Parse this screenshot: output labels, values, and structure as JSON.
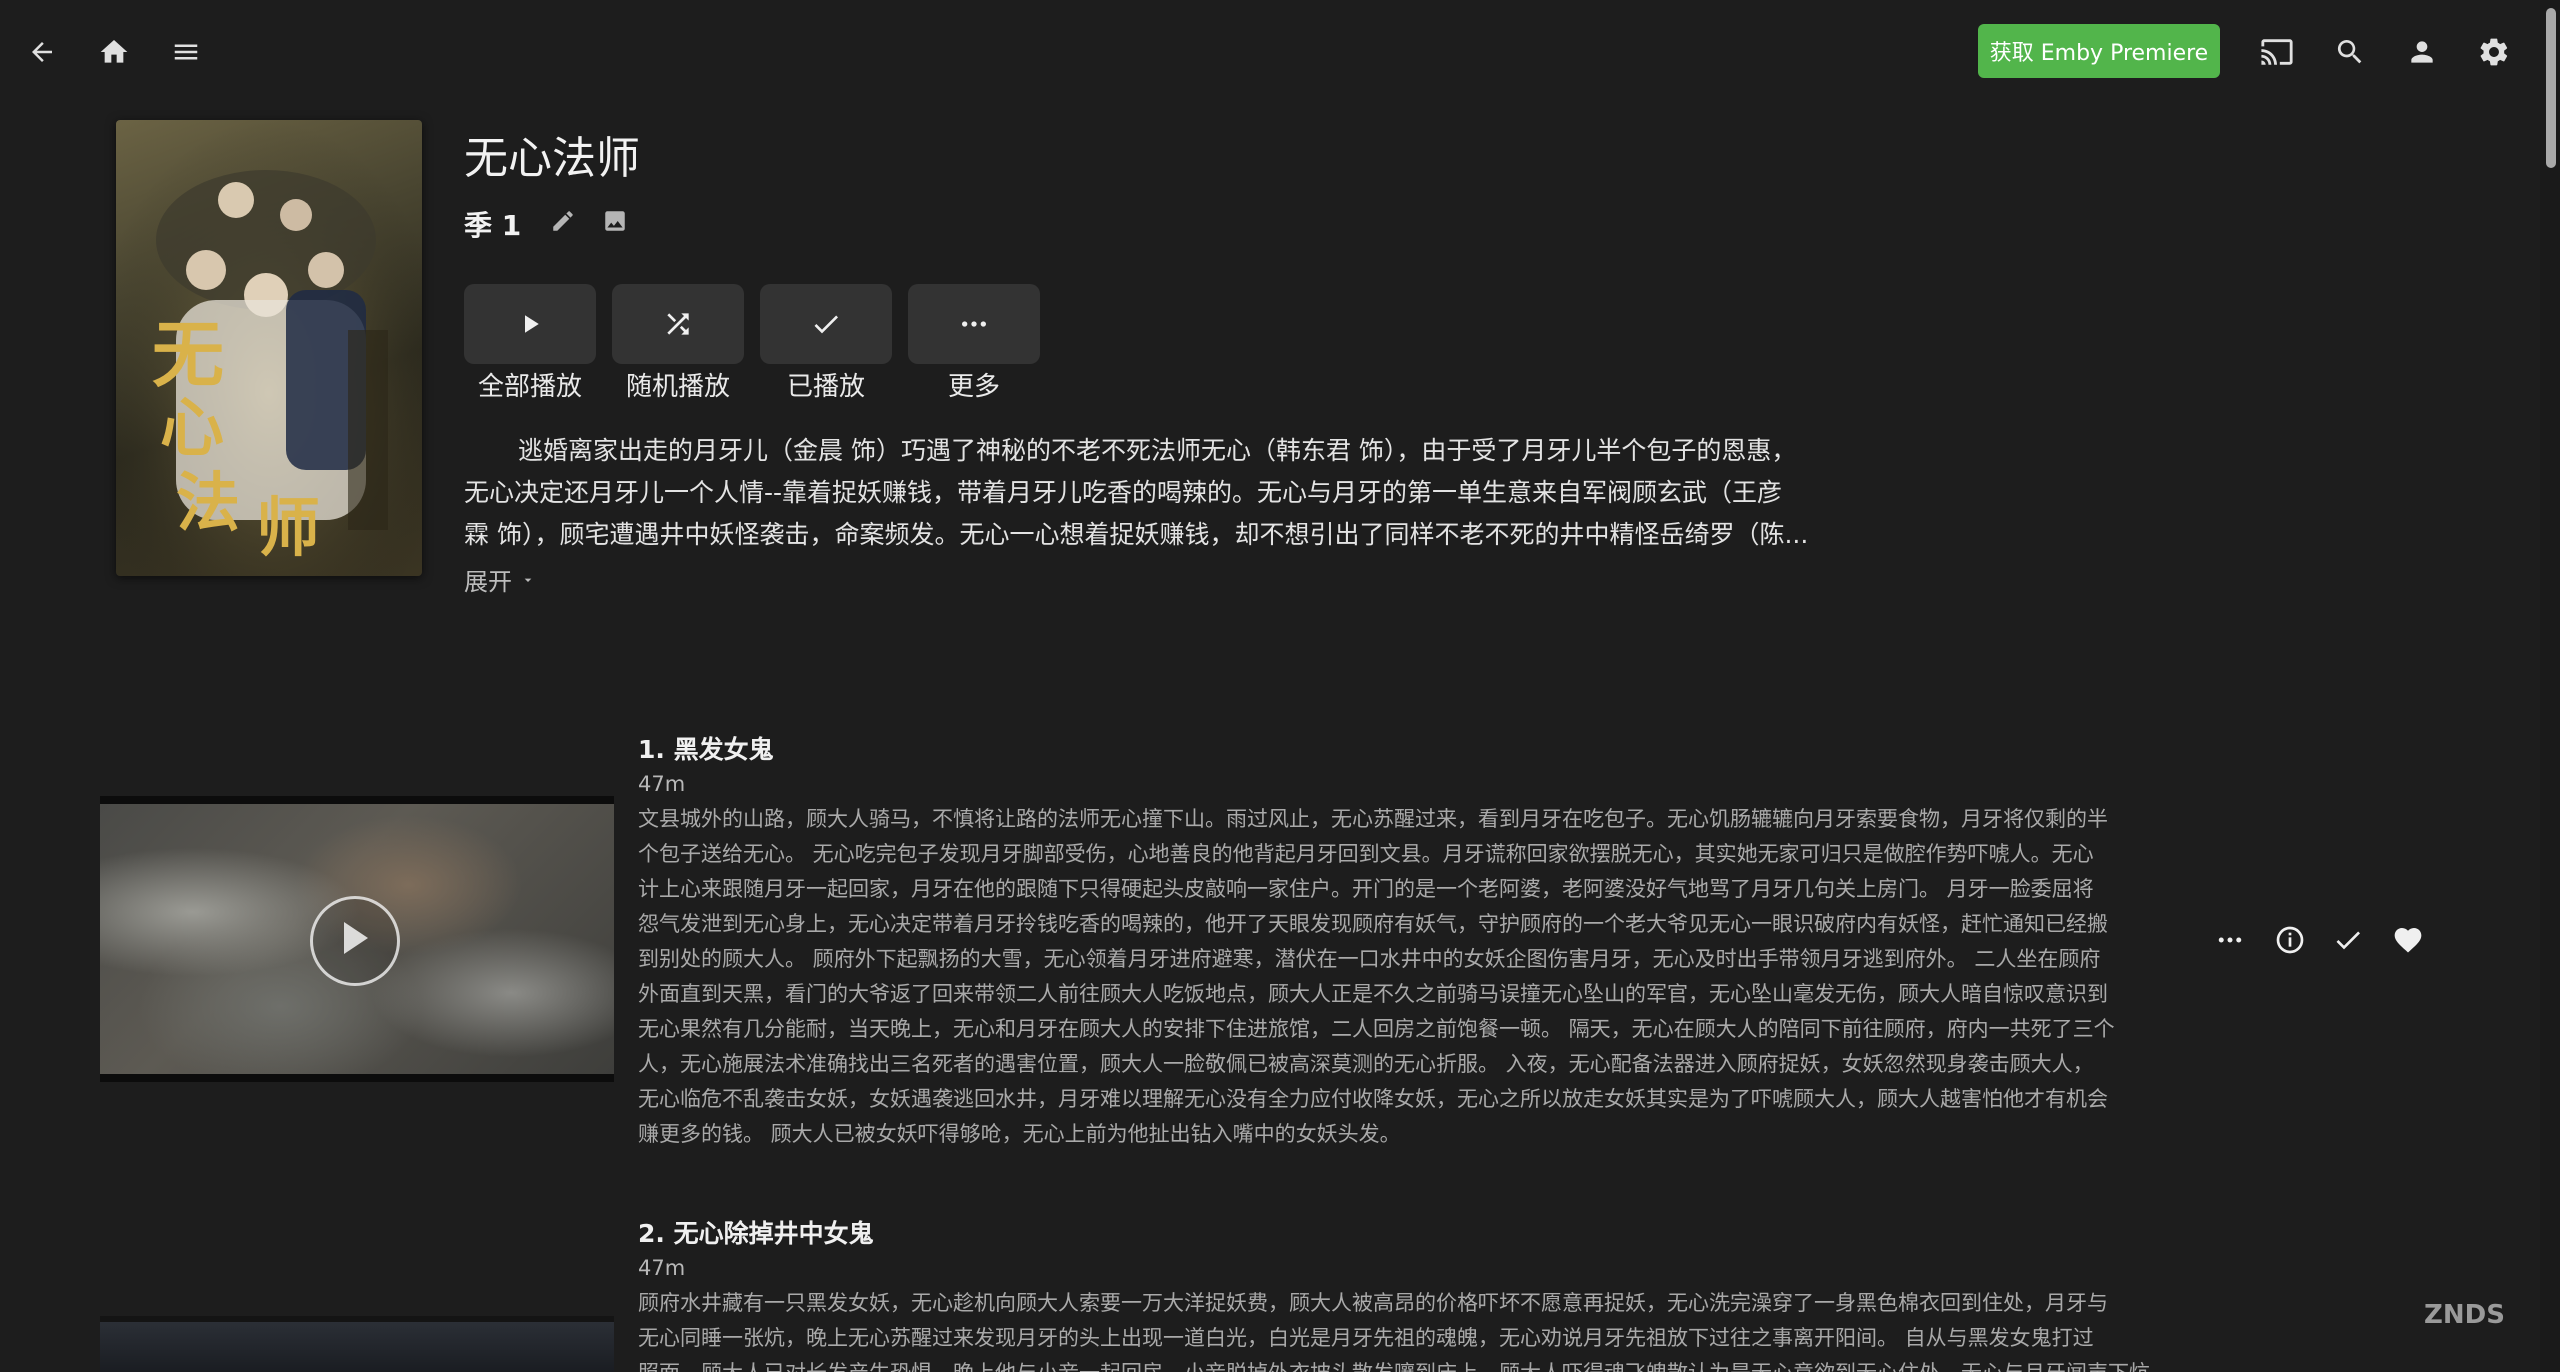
{
  "header": {
    "back_icon": "arrow-left-icon",
    "home_icon": "home-icon",
    "menu_icon": "hamburger-menu-icon",
    "premiere_label": "获取 Emby Premiere",
    "premiere_color": "#52b54b",
    "cast_icon": "cast-icon",
    "search_icon": "search-icon",
    "user_icon": "user-icon",
    "settings_icon": "gear-icon"
  },
  "show": {
    "title": "无心法师",
    "season": "季 1",
    "edit_icon": "pencil-icon",
    "image_icon": "image-icon",
    "overview_lines": [
      "逃婚离家出走的月牙儿（金晨 饰）巧遇了神秘的不老不死法师无心（韩东君 饰），由于受了月牙儿半个包子的恩惠，",
      "无心决定还月牙儿一个人情--靠着捉妖赚钱，带着月牙儿吃香的喝辣的。无心与月牙的第一单生意来自军阀顾玄武（王彦",
      "霖 饰），顾宅遭遇井中妖怪袭击，命案频发。无心一心想着捉妖赚钱，却不想引出了同样不老不死的井中精怪岳绮罗（陈..."
    ],
    "expand_label": "展开"
  },
  "actions": [
    {
      "label": "全部播放",
      "icon": "play-icon"
    },
    {
      "label": "随机播放",
      "icon": "shuffle-icon"
    },
    {
      "label": "已播放",
      "icon": "check-icon"
    },
    {
      "label": "更多",
      "icon": "more-horizontal-icon"
    }
  ],
  "episodes": [
    {
      "title": "1. 黑发女鬼",
      "runtime": "47m",
      "overview_lines": [
        "文县城外的山路，顾大人骑马，不慎将让路的法师无心撞下山。雨过风止，无心苏醒过来，看到月牙在吃包子。无心饥肠辘辘向月牙索要食物，月牙将仅剩的半",
        "个包子送给无心。 无心吃完包子发现月牙脚部受伤，心地善良的他背起月牙回到文县。月牙谎称回家欲摆脱无心，其实她无家可归只是做腔作势吓唬人。无心",
        "计上心来跟随月牙一起回家，月牙在他的跟随下只得硬起头皮敲响一家住户。开门的是一个老阿婆，老阿婆没好气地骂了月牙几句关上房门。 月牙一脸委屈将",
        "怨气发泄到无心身上，无心决定带着月牙拎钱吃香的喝辣的，他开了天眼发现顾府有妖气，守护顾府的一个老大爷见无心一眼识破府内有妖怪，赶忙通知已经搬",
        "到别处的顾大人。 顾府外下起飘扬的大雪，无心领着月牙进府避寒，潜伏在一口水井中的女妖企图伤害月牙，无心及时出手带领月牙逃到府外。 二人坐在顾府",
        "外面直到天黑，看门的大爷返了回来带领二人前往顾大人吃饭地点，顾大人正是不久之前骑马误撞无心坠山的军官，无心坠山毫发无伤，顾大人暗自惊叹意识到",
        "无心果然有几分能耐，当天晚上，无心和月牙在顾大人的安排下住进旅馆，二人回房之前饱餐一顿。 隔天，无心在顾大人的陪同下前往顾府，府内一共死了三个",
        "人，无心施展法术准确找出三名死者的遇害位置，顾大人一脸敬佩已被高深莫测的无心折服。 入夜，无心配备法器进入顾府捉妖，女妖忽然现身袭击顾大人，",
        "无心临危不乱袭击女妖，女妖遇袭逃回水井，月牙难以理解无心没有全力应付收降女妖，无心之所以放走女妖其实是为了吓唬顾大人，顾大人越害怕他才有机会",
        "赚更多的钱。 顾大人已被女妖吓得够呛，无心上前为他扯出钻入嘴中的女妖头发。"
      ],
      "more_icon": "more-horizontal-icon",
      "info_icon": "info-icon",
      "played_icon": "check-icon",
      "favorite_icon": "heart-icon"
    },
    {
      "title": "2. 无心除掉井中女鬼",
      "runtime": "47m",
      "overview_lines": [
        "顾府水井藏有一只黑发女妖，无心趁机向顾大人索要一万大洋捉妖费，顾大人被高昂的价格吓坏不愿意再捉妖，无心洗完澡穿了一身黑色棉衣回到住处，月牙与",
        "无心同睡一张炕，晚上无心苏醒过来发现月牙的头上出现一道白光，白光是月牙先祖的魂魄，无心劝说月牙先祖放下过往之事离开阳间。 自从与黑发女鬼打过",
        "照面，顾大人已对长发产生恐惧，晚上他与小妾一起回房，小妾脱掉外衣披头散发嚷到床上，顾大人吓得魂飞魄散认为是无心意欲到无心住处，无心与月牙闻声下炕"
      ]
    }
  ],
  "watermark": "ZNDS"
}
